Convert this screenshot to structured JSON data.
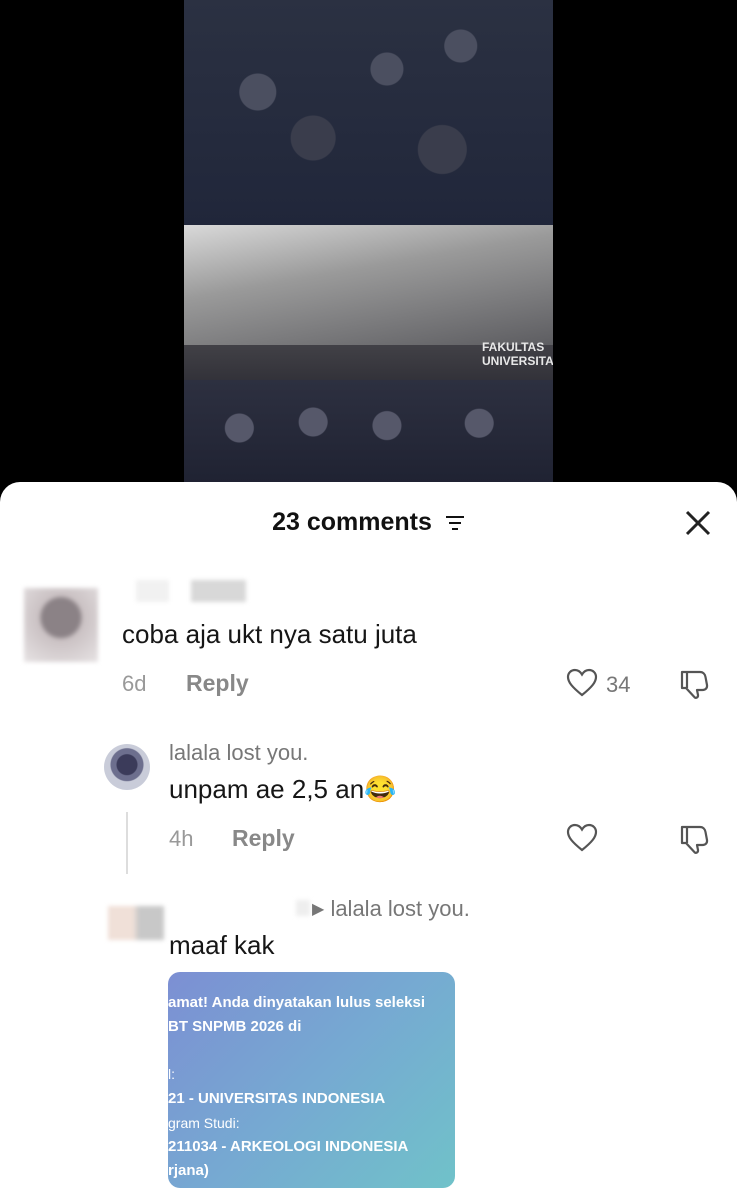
{
  "video": {
    "sign_line1": "FAKULTAS",
    "sign_line2": "UNIVERSITAS"
  },
  "panel": {
    "title": "23 comments",
    "close_label": "close"
  },
  "comments": [
    {
      "body": "coba aja ukt nya satu juta",
      "time": "6d",
      "reply_label": "Reply",
      "likes": "34"
    },
    {
      "username": "lalala lost you.",
      "body": "unpam ae 2,5 an",
      "emoji": "😂",
      "time": "4h",
      "reply_label": "Reply"
    },
    {
      "reply_to": "lalala lost you.",
      "body": "maaf kak",
      "card": {
        "line1": "amat! Anda dinyatakan lulus seleksi",
        "line2": "BT SNPMB 2026 di",
        "line3": "l:",
        "line4": "21 - UNIVERSITAS INDONESIA",
        "line5": "gram Studi:",
        "line6": "211034 - ARKEOLOGI INDONESIA",
        "line7": "rjana)"
      }
    }
  ],
  "colors": {
    "accent_text": "#161616",
    "muted_text": "#888888",
    "card_gradient_start": "#7c8fd3",
    "card_gradient_end": "#70c2c9"
  }
}
